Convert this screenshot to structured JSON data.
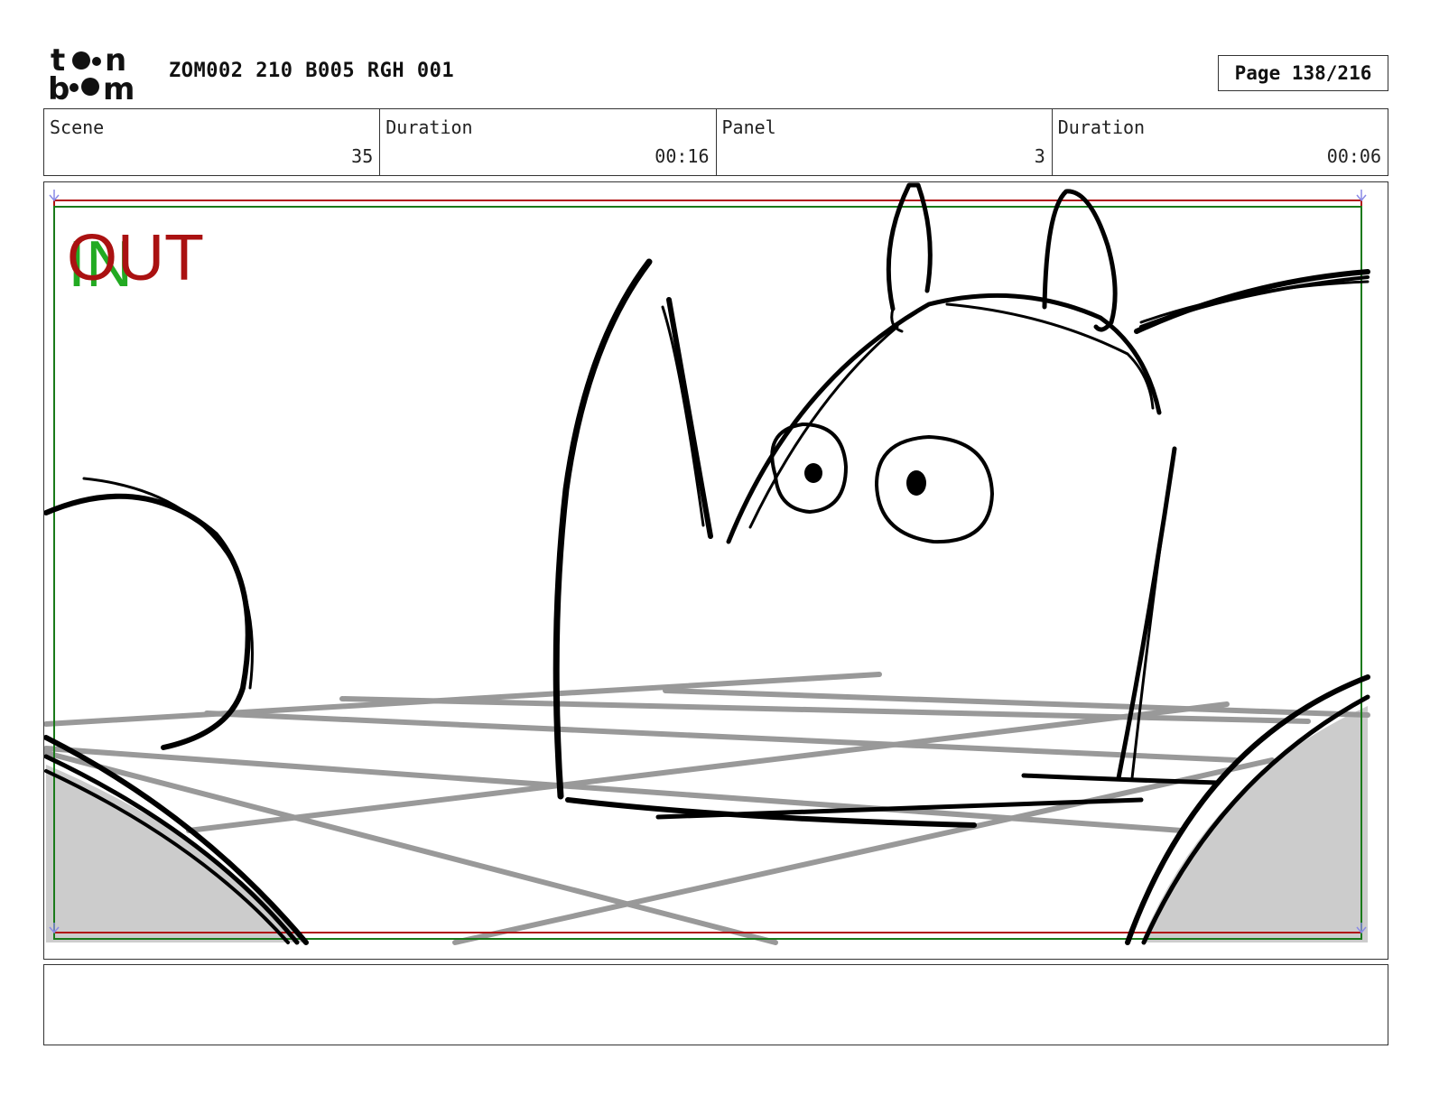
{
  "header": {
    "logo_text": [
      "t",
      "n",
      "b",
      "m"
    ],
    "project_title": "ZOM002 210 B005 RGH 001",
    "page_label": "Page 138/216"
  },
  "info": [
    {
      "label": "Scene",
      "value": "35"
    },
    {
      "label": "Duration",
      "value": "00:16"
    },
    {
      "label": "Panel",
      "value": "3"
    },
    {
      "label": "Duration",
      "value": "00:06"
    }
  ],
  "panel": {
    "in_marker": "IN",
    "out_marker": "OUT",
    "colors": {
      "safe_frame_red": "#b01010",
      "safe_frame_green": "#1a7a1a",
      "in_green": "#22aa22",
      "out_red": "#aa1111",
      "grid_grey": "#999999",
      "fill_grey": "#cccccc",
      "ink": "#000000"
    }
  },
  "notes": {
    "text": ""
  }
}
